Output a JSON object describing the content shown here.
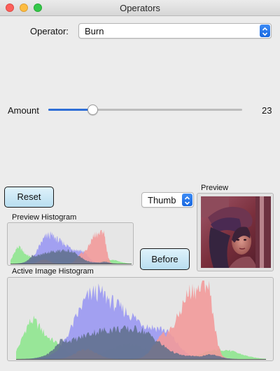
{
  "window": {
    "title": "Operators"
  },
  "operator": {
    "label": "Operator:",
    "selected": "Burn"
  },
  "amount": {
    "label": "Amount",
    "value": 23,
    "min": 0,
    "max": 100,
    "display": "23"
  },
  "buttons": {
    "reset": "Reset",
    "before": "Before"
  },
  "thumb_select": {
    "selected": "Thumb"
  },
  "labels": {
    "preview": "Preview",
    "preview_histogram": "Preview Histogram",
    "active_histogram": "Active Image Histogram"
  },
  "colors": {
    "red": "#f29a9a",
    "green": "#8fe58f",
    "blue": "#9a98f2",
    "gray": "#5e6e8a",
    "accent": "#1767e0"
  },
  "icons": [
    "close-icon",
    "minimize-icon",
    "zoom-icon",
    "updown-chevron-icon"
  ]
}
